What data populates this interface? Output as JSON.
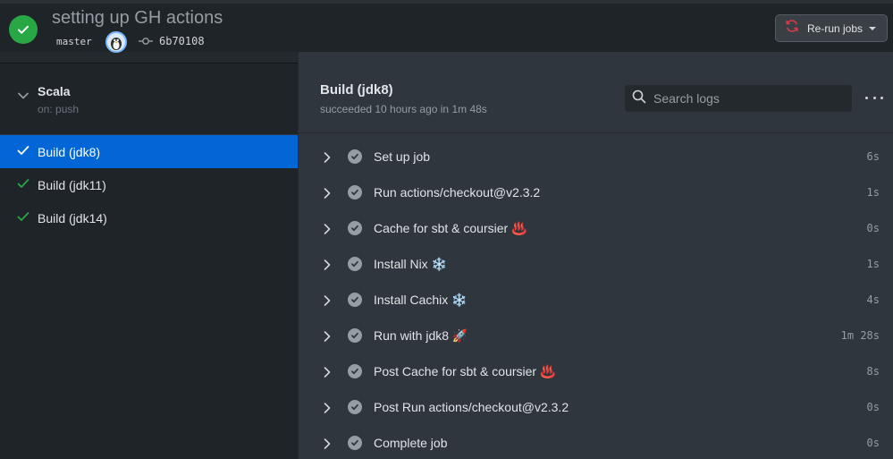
{
  "header": {
    "title": "setting up GH actions",
    "branch": "master",
    "commit_sha": "6b70108",
    "rerun_label": "Re-run jobs",
    "status_icon": "check-circle-icon",
    "accent_success": "#28a745"
  },
  "sidebar": {
    "workflow": {
      "name": "Scala",
      "trigger": "on: push"
    },
    "jobs": [
      {
        "label": "Build (jdk8)",
        "status": "success",
        "active": true
      },
      {
        "label": "Build (jdk11)",
        "status": "success",
        "active": false
      },
      {
        "label": "Build (jdk14)",
        "status": "success",
        "active": false
      }
    ]
  },
  "main": {
    "job_title": "Build (jdk8)",
    "job_subtitle": "succeeded 10 hours ago in 1m 48s",
    "search_placeholder": "Search logs",
    "steps": [
      {
        "label": "Set up job",
        "duration": "6s"
      },
      {
        "label": "Run actions/checkout@v2.3.2",
        "duration": "1s"
      },
      {
        "label": "Cache for sbt & coursier ♨️",
        "duration": "0s"
      },
      {
        "label": "Install Nix ❄️",
        "duration": "1s"
      },
      {
        "label": "Install Cachix ❄️",
        "duration": "4s"
      },
      {
        "label": "Run with jdk8 🚀",
        "duration": "1m 28s"
      },
      {
        "label": "Post Cache for sbt & coursier ♨️",
        "duration": "8s"
      },
      {
        "label": "Post Run actions/checkout@v2.3.2",
        "duration": "0s"
      },
      {
        "label": "Complete job",
        "duration": "0s"
      }
    ]
  }
}
